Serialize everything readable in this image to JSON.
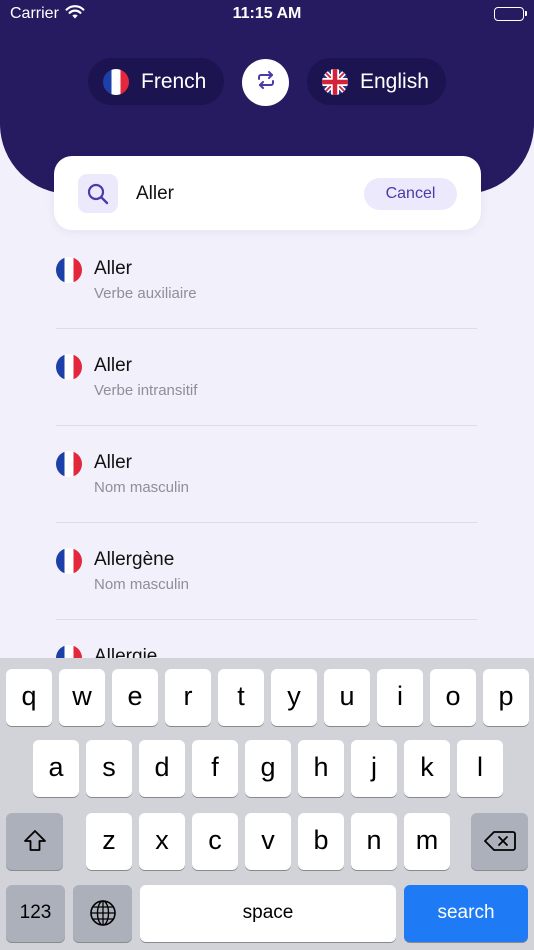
{
  "status_bar": {
    "carrier": "Carrier",
    "time": "11:15 AM"
  },
  "language_switcher": {
    "source": {
      "label": "French",
      "flag_icon": "france-flag-icon"
    },
    "swap_icon": "swap-arrows-icon",
    "target": {
      "label": "English",
      "flag_icon": "uk-flag-icon"
    }
  },
  "search": {
    "value": "Aller",
    "icon": "search-icon",
    "cancel_label": "Cancel"
  },
  "results": [
    {
      "word": "Aller",
      "type": "Verbe auxiliaire",
      "flag_icon": "france-flag-icon"
    },
    {
      "word": "Aller",
      "type": "Verbe intransitif",
      "flag_icon": "france-flag-icon"
    },
    {
      "word": "Aller",
      "type": "Nom masculin",
      "flag_icon": "france-flag-icon"
    },
    {
      "word": "Allergène",
      "type": "Nom masculin",
      "flag_icon": "france-flag-icon"
    },
    {
      "word": "Allergie",
      "type": "",
      "flag_icon": "france-flag-icon"
    }
  ],
  "keyboard": {
    "row1": [
      "q",
      "w",
      "e",
      "r",
      "t",
      "y",
      "u",
      "i",
      "o",
      "p"
    ],
    "row2": [
      "a",
      "s",
      "d",
      "f",
      "g",
      "h",
      "j",
      "k",
      "l"
    ],
    "row3": [
      "z",
      "x",
      "c",
      "v",
      "b",
      "n",
      "m"
    ],
    "numbers_label": "123",
    "space_label": "space",
    "search_label": "search",
    "shift_icon": "shift-icon",
    "delete_icon": "backspace-icon",
    "globe_icon": "globe-icon"
  },
  "colors": {
    "header": "#261b60",
    "accent": "#4b3aa8",
    "search_key": "#1e7af5"
  }
}
